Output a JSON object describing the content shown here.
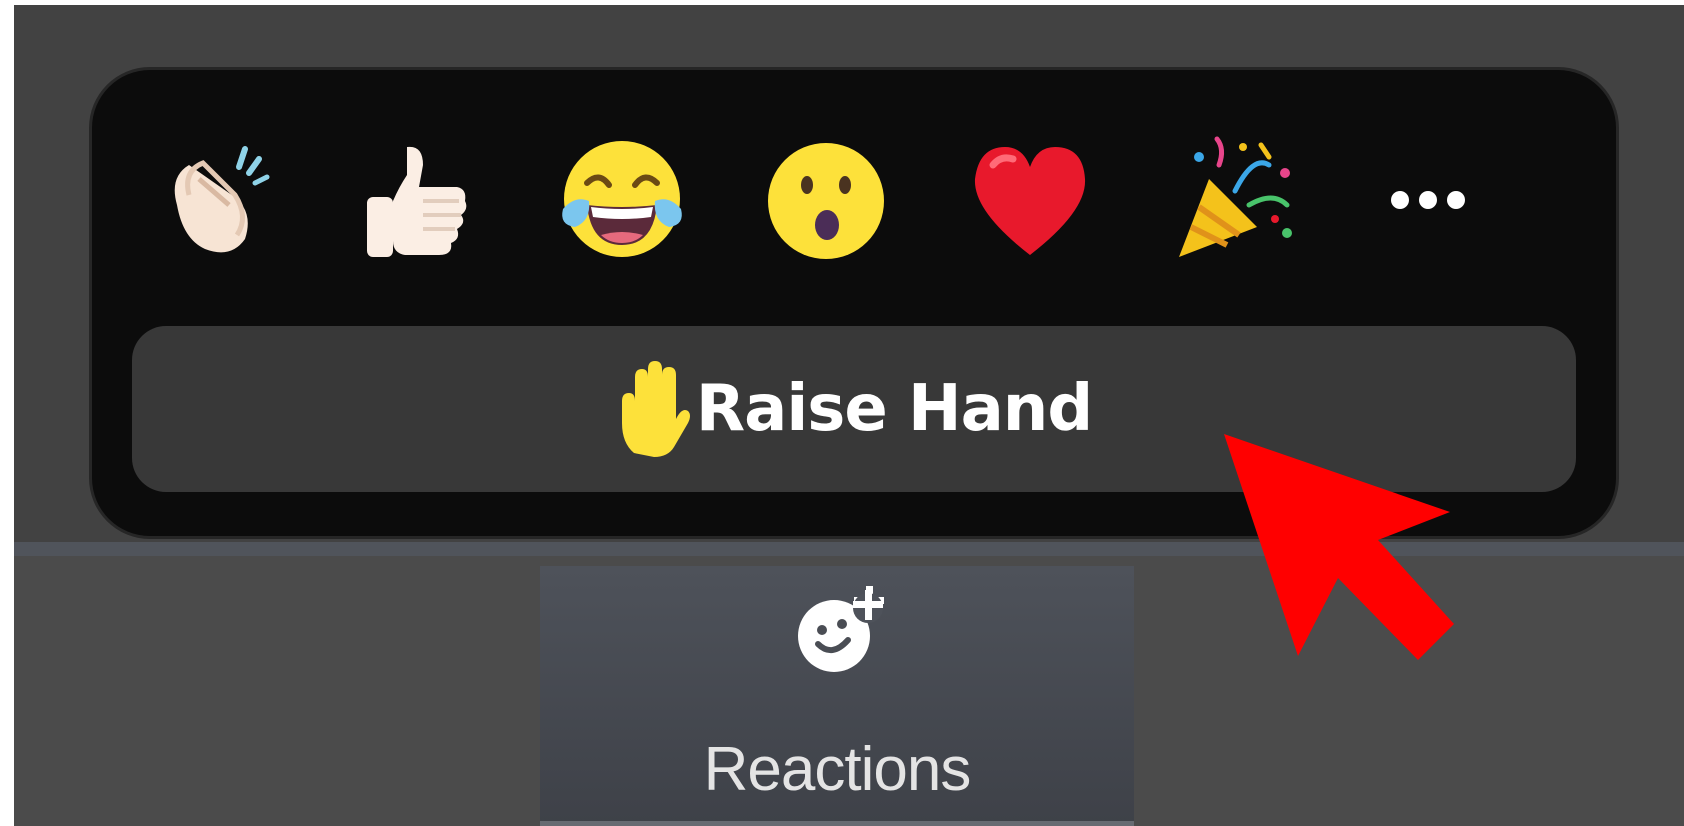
{
  "reaction_panel": {
    "emojis": [
      {
        "name": "clapping-hands",
        "glyph": "👏"
      },
      {
        "name": "thumbs-up",
        "glyph": "👍"
      },
      {
        "name": "tears-of-joy",
        "glyph": "😂"
      },
      {
        "name": "open-mouth",
        "glyph": "😮"
      },
      {
        "name": "red-heart",
        "glyph": "❤️"
      },
      {
        "name": "party-popper",
        "glyph": "🎉"
      }
    ],
    "more_icon": "more-horizontal-icon",
    "raise_hand_icon": "raised-hand-icon",
    "raise_hand_label": "Raise Hand"
  },
  "toolbar": {
    "reactions_icon": "add-reaction-icon",
    "reactions_label": "Reactions"
  },
  "colors": {
    "annotation_arrow": "#ff0000",
    "panel_background": "#0c0c0c",
    "raise_hand_button": "#383838",
    "toolbar_background": "#4b4b4b"
  }
}
